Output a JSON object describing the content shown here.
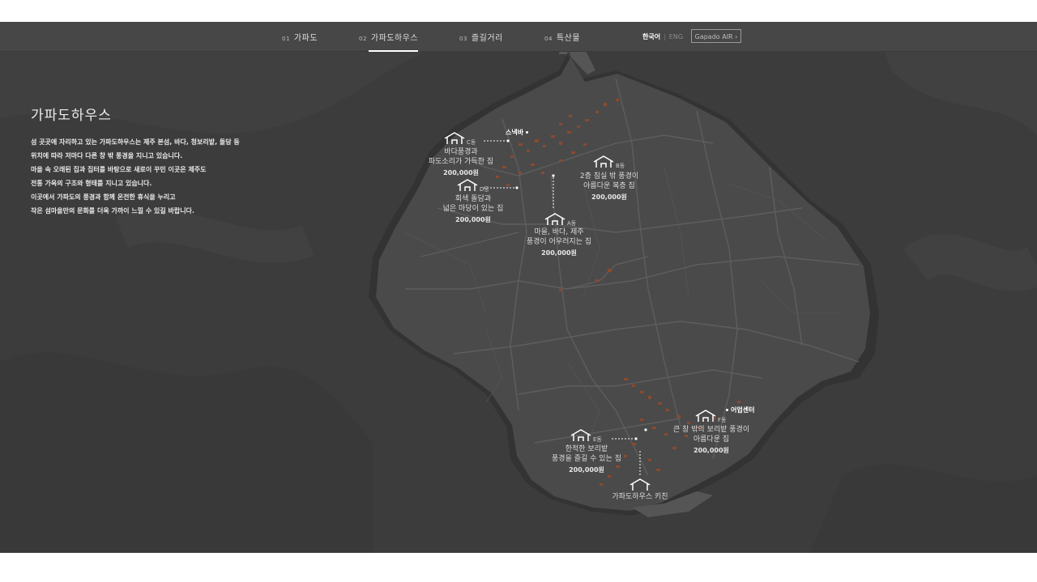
{
  "nav": {
    "items": [
      {
        "num": "01",
        "label": "가파도"
      },
      {
        "num": "02",
        "label": "가파도하우스"
      },
      {
        "num": "03",
        "label": "즐길거리"
      },
      {
        "num": "04",
        "label": "특산물"
      }
    ],
    "lang_ko": "한국어",
    "lang_sep": "|",
    "lang_en": "ENG",
    "air_button": "Gapado AIR",
    "air_arrow": "›"
  },
  "page": {
    "title": "가파도하우스",
    "description": [
      "섬 곳곳에 자리하고 있는 가파도하우스는 제주 본섬, 바다, 청보리밭, 돌담 등",
      "위치에 따라 저마다 다른 창 밖 풍경을 지니고 있습니다.",
      "마을 속 오래된 집과 집터를 바탕으로 새로이 꾸민 이곳은 제주도",
      "전통 가옥의 구조와 형태를 지니고 있습니다.",
      "이곳에서 가파도의 풍경과 함께 온전한 휴식을 누리고",
      "작은 섬마을만의 문화를 더욱 가까이 느낄 수 있길 바랍니다."
    ]
  },
  "houses": {
    "C": {
      "tag": "C동",
      "lines": [
        "바다풍경과",
        "파도소리가 가득한 집"
      ],
      "price": "200,000원"
    },
    "D": {
      "tag": "D동",
      "lines": [
        "회색 돌담과",
        "넓은 마당이 있는 집"
      ],
      "price": "200,000원"
    },
    "B": {
      "tag": "B동",
      "lines": [
        "2층 침실 밖 풍경이",
        "아름다운 복층 집"
      ],
      "price": "200,000원"
    },
    "A": {
      "tag": "A동",
      "lines": [
        "마을, 바다, 제주",
        "풍경이 어우러지는 집"
      ],
      "price": "200,000원"
    },
    "E": {
      "tag": "E동",
      "lines": [
        "한적한 보리밭",
        "풍경을 즐길 수 있는 집"
      ],
      "price": "200,000원"
    },
    "F": {
      "tag": "F동",
      "lines": [
        "큰 창 밖의 보리밭 풍경이",
        "아름다운 집"
      ],
      "price": "200,000원"
    },
    "K": {
      "tag": "",
      "lines": [
        "가파도하우스 키친"
      ],
      "price": ""
    }
  },
  "pois": {
    "snackbar": "스낵바",
    "fishery_center": "어업센터"
  },
  "colors": {
    "background": "#3c3c3c",
    "island": "#4a4a4a",
    "roads": "#5c5c5c",
    "houses_marks": "#8a4a2e",
    "text": "#e0e0e0"
  }
}
